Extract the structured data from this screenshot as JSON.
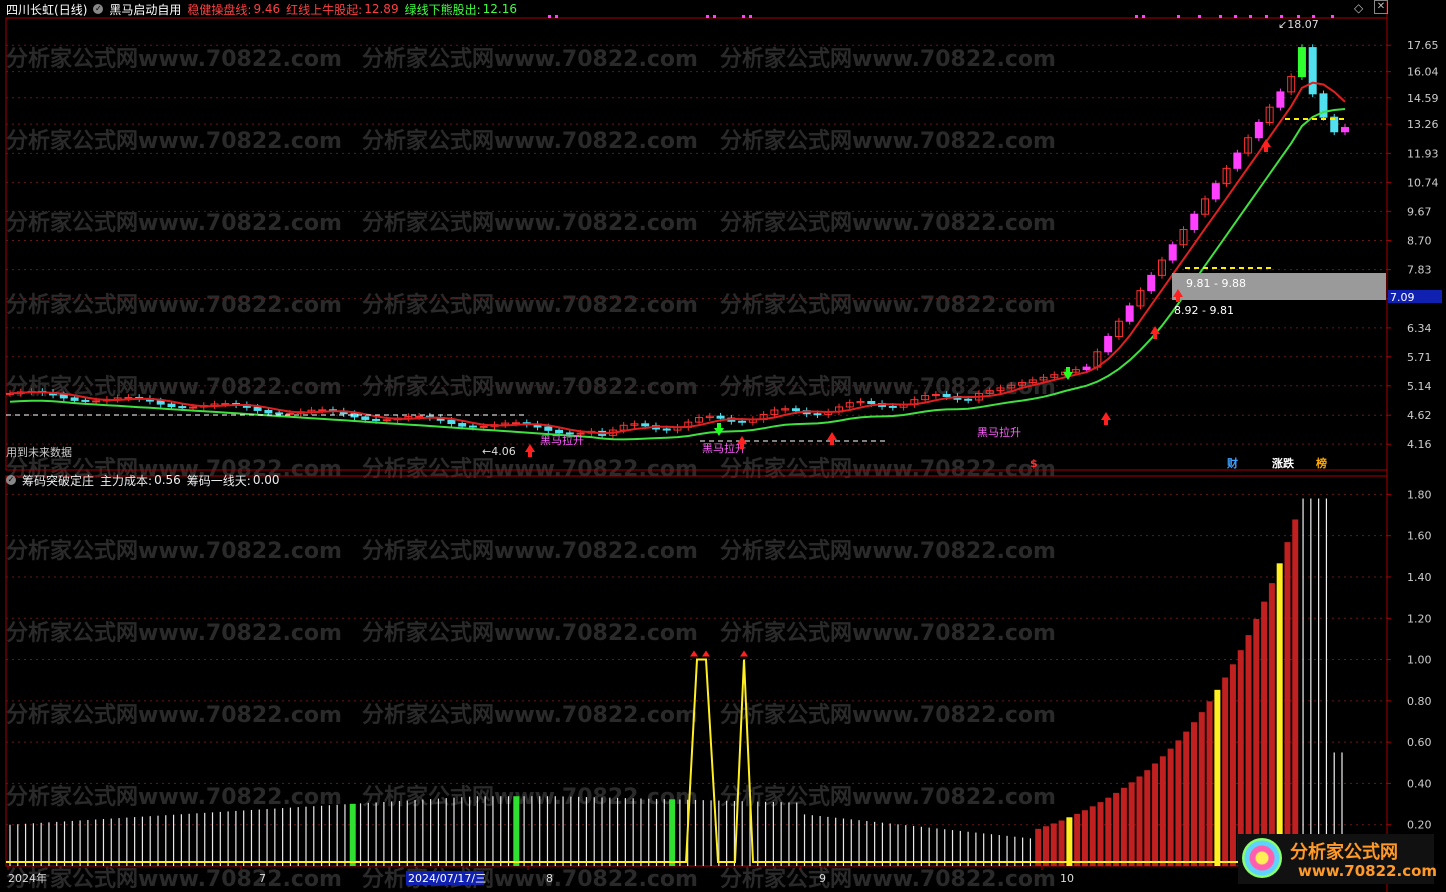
{
  "header": {
    "stock_name": "四川长虹",
    "period": "(日线)",
    "indicator_name": "黑马启动自用",
    "line1_label": "稳健操盘线:",
    "line1_value": "9.46",
    "line2_label": "红线上牛股起:",
    "line2_value": "12.89",
    "line3_label": "绿线下熊股出:",
    "line3_value": "12.16",
    "colors": {
      "line1": "#ff4040",
      "line2": "#ff4040",
      "line3": "#40ff40"
    }
  },
  "watermark_text": "分析家公式网www.70822.com",
  "main_panel": {
    "price_axis": [
      "17.65",
      "16.04",
      "14.59",
      "13.26",
      "11.93",
      "10.74",
      "9.67",
      "8.70",
      "7.83",
      "7.05",
      "6.34",
      "5.71",
      "5.14",
      "4.62",
      "4.16"
    ],
    "current_price_tag": "7.09",
    "annotations": {
      "high_label": "18.07",
      "low_label": "4.06",
      "future_data": "用到未来数据",
      "range1": "9.81 - 9.88",
      "range2": "8.92 - 9.81",
      "signal1": "黑马拉升",
      "signal2": "黑马拉升",
      "signal3": "黑马拉升"
    },
    "badges": [
      {
        "text": "$",
        "color": "#ff3030"
      },
      {
        "text": "财",
        "color": "#3fa0ff"
      },
      {
        "text": "涨跌",
        "color": "#ffffff"
      },
      {
        "text": "榜",
        "color": "#ffaa00"
      }
    ]
  },
  "lower_panel": {
    "indicator_name": "筹码突破定庄",
    "label1": "主力成本:",
    "value1": "0.56",
    "label2": "筹码一线天:",
    "value2": "0.00",
    "axis": [
      "1.80",
      "1.60",
      "1.40",
      "1.20",
      "1.00",
      "0.80",
      "0.60",
      "0.40",
      "0.20"
    ]
  },
  "time_axis": {
    "labels": [
      "2024年",
      "7",
      "8",
      "9",
      "10"
    ],
    "cursor_date": "2024/07/17/三"
  },
  "logo": {
    "text": "分析家公式网",
    "url": "www.70822.com"
  }
}
